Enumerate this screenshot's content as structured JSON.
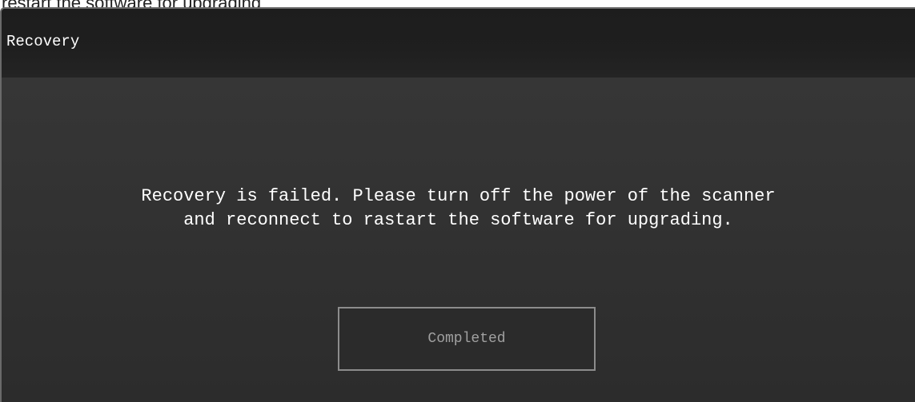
{
  "background": {
    "caption": "restart the software for upgrading"
  },
  "dialog": {
    "title": "Recovery",
    "message_lines": [
      "Recovery is failed. Please turn off the power of the scanner",
      "and reconnect to rastart the software for upgrading."
    ],
    "button_label": "Completed"
  },
  "colors": {
    "title_bar": "#1f1f1f",
    "body": "#333333",
    "text": "#ffffff",
    "button_border": "#8c8c8c",
    "button_text": "#a0a0a0"
  }
}
